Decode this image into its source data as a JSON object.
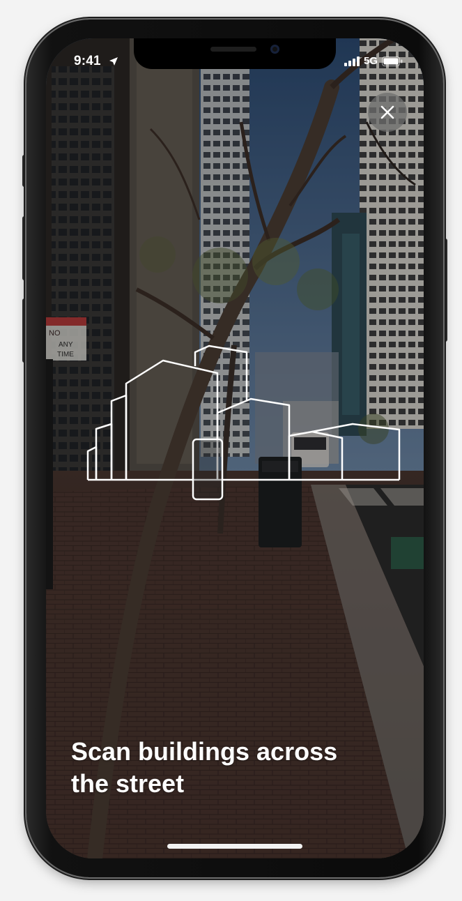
{
  "status_bar": {
    "time": "9:41",
    "network": "5G",
    "icons": [
      "location-arrow-icon",
      "signal-bars-icon",
      "battery-icon"
    ]
  },
  "close_button": {
    "icon": "close-icon"
  },
  "instruction": {
    "line1": "Scan buildings across",
    "line2": "the street"
  },
  "sign": {
    "line1": "NO",
    "line2": "ANY",
    "line3": "TIME"
  },
  "colors": {
    "outline": "#ffffff",
    "close_button_bg": "#6e6e6e",
    "text": "#ffffff"
  }
}
